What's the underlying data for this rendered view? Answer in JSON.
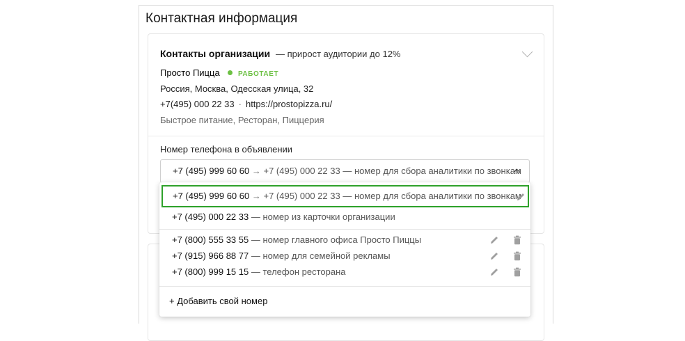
{
  "section": {
    "title": "Контактная информация"
  },
  "organization": {
    "heading": "Контакты организации",
    "heading_sub": "— прирост аудитории до 12%",
    "name": "Просто Пицца",
    "status": "РАБОТАЕТ",
    "address": "Россия, Москва, Одесская улица, 32",
    "phone": "+7(495) 000 22 33",
    "site": "https://prostopizza.ru/",
    "categories": "Быстрое питание, Ресторан, Пиццерия"
  },
  "phone_select": {
    "label": "Номер телефона в объявлении",
    "value_phone": "+7 (495) 999 60 60",
    "value_target": "+7 (495) 000 22 33",
    "value_desc": "— номер для сбора аналитики по звонкам",
    "arrow": "→"
  },
  "dropdown": {
    "selected": {
      "phone": "+7 (495) 999 60 60",
      "target": "+7 (495) 000 22 33",
      "desc": "— номер для сбора аналитики по звонкам",
      "arrow": "→"
    },
    "card_option": {
      "phone": "+7 (495) 000 22 33",
      "desc": "— номер из карточки организации"
    },
    "custom": [
      {
        "phone": "+7 (800) 555 33 55",
        "desc": "— номер главного офиса Просто Пиццы"
      },
      {
        "phone": "+7 (915) 966 88 77",
        "desc": "— номер для семейной рекламы"
      },
      {
        "phone": "+7 (800) 999 15 15",
        "desc": "— телефон ресторана"
      }
    ],
    "add_label": "+ Добавить свой номер"
  },
  "colors": {
    "accent_green": "#2ea12a",
    "status_green": "#6cc043"
  }
}
